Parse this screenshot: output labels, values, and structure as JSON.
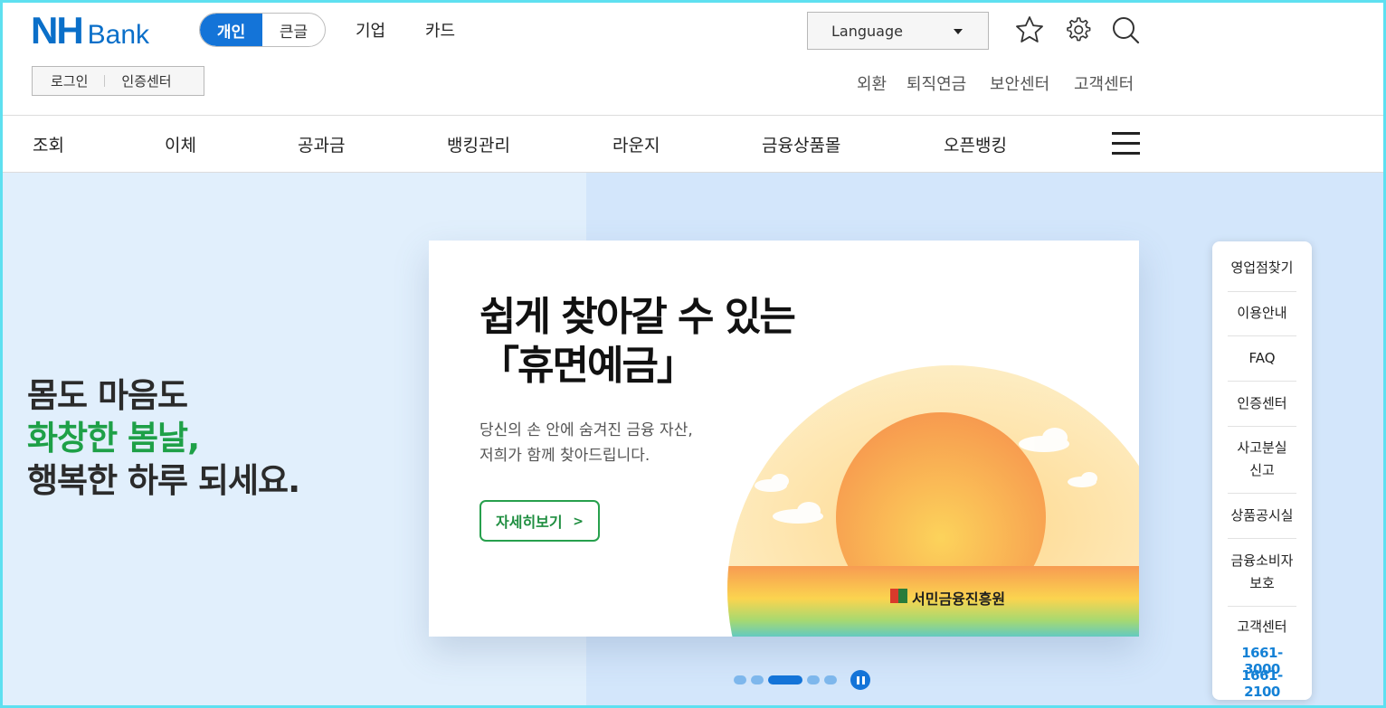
{
  "header": {
    "logo_nh": "NH",
    "logo_bank": "Bank",
    "toggle": {
      "personal": "개인",
      "large": "큰글"
    },
    "links": {
      "corporate": "기업",
      "card": "카드"
    },
    "language_label": "Language",
    "login": "로그인",
    "cert_center": "인증센터",
    "util_links": [
      "외환",
      "퇴직연금",
      "보안센터",
      "고객센터"
    ]
  },
  "gnb": {
    "items": [
      "조회",
      "이체",
      "공과금",
      "뱅킹관리",
      "라운지",
      "금융상품몰",
      "오픈뱅킹"
    ]
  },
  "hero": {
    "line1": "몸도 마음도",
    "line2": "화창한 봄날,",
    "line3": "행복한 하루 되세요."
  },
  "banner": {
    "title1": "쉽게 찾아갈 수 있는",
    "title2": "「휴면예금」",
    "desc1": "당신의 손 안에 숨겨진 금융 자산,",
    "desc2": "저희가 함께 찾아드립니다.",
    "button": "자세히보기",
    "logo_text": "서민금융진흥원"
  },
  "carousel": {
    "total": 5,
    "active_index": 2
  },
  "quick_menu": {
    "items": [
      "영업점찾기",
      "이용안내",
      "FAQ",
      "인증센터",
      "사고분실",
      "신고",
      "상품공시실",
      "금융소비자",
      "보호",
      "고객센터"
    ],
    "phones": [
      "1661-3000",
      "1661-2100"
    ]
  },
  "colors": {
    "brand_blue": "#1474d8",
    "green": "#1ea047",
    "hero_left_bg": "#e1effc",
    "hero_right_bg": "#d3e6fb",
    "phone_blue": "#1481d6"
  }
}
